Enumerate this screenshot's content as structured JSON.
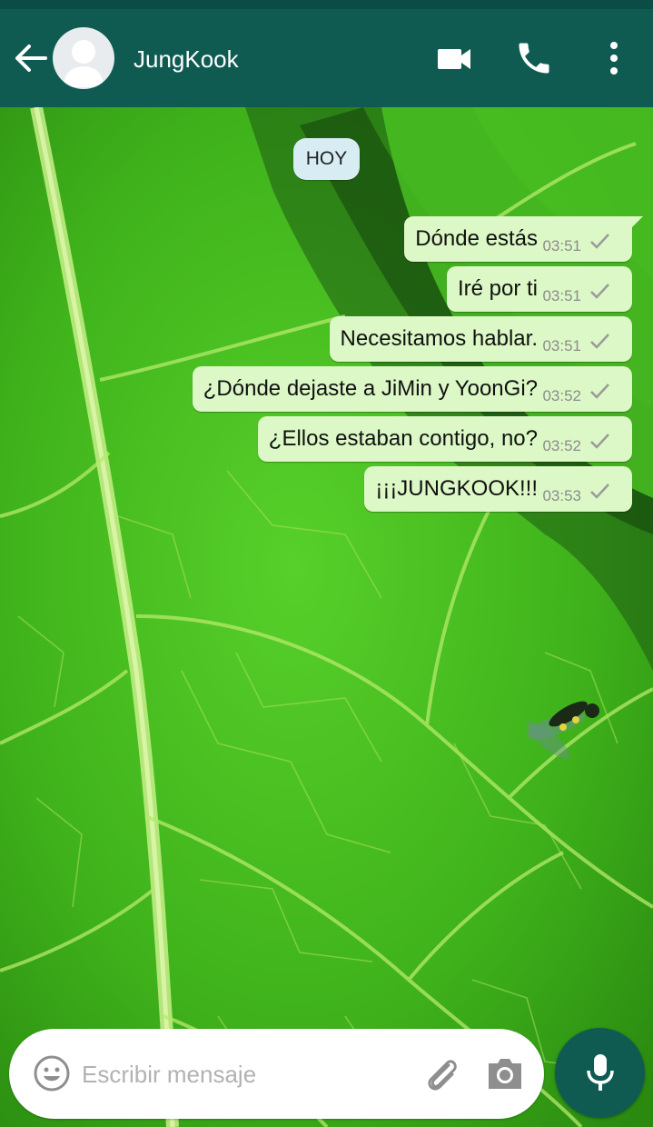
{
  "header": {
    "contact_name": "JungKook"
  },
  "chat": {
    "date_chip": "HOY",
    "messages": [
      {
        "text": "Dónde estás",
        "time": "03:51",
        "status": "sent"
      },
      {
        "text": "Iré por ti",
        "time": "03:51",
        "status": "sent"
      },
      {
        "text": "Necesitamos hablar.",
        "time": "03:51",
        "status": "sent"
      },
      {
        "text": "¿Dónde dejaste a JiMin y YoonGi?",
        "time": "03:52",
        "status": "sent"
      },
      {
        "text": "¿Ellos estaban contigo, no?",
        "time": "03:52",
        "status": "sent"
      },
      {
        "text": "¡¡¡JUNGKOOK!!!",
        "time": "03:53",
        "status": "sent"
      }
    ]
  },
  "composer": {
    "placeholder": "Escribir mensaje"
  },
  "icons": {
    "back": "arrow-left-icon",
    "video": "videocam-icon",
    "call": "phone-icon",
    "menu": "more-vert-icon",
    "emoji": "smiley-icon",
    "attach": "paperclip-icon",
    "camera": "camera-icon",
    "mic": "microphone-icon",
    "sent": "check-icon"
  },
  "colors": {
    "appbar": "#0f5b52",
    "statusbar": "#0b4d45",
    "bubble_outgoing": "#dcf8c6",
    "date_chip": "#d8ecf4",
    "mic_button": "#0f5b52",
    "tick": "#9a9a9a"
  }
}
